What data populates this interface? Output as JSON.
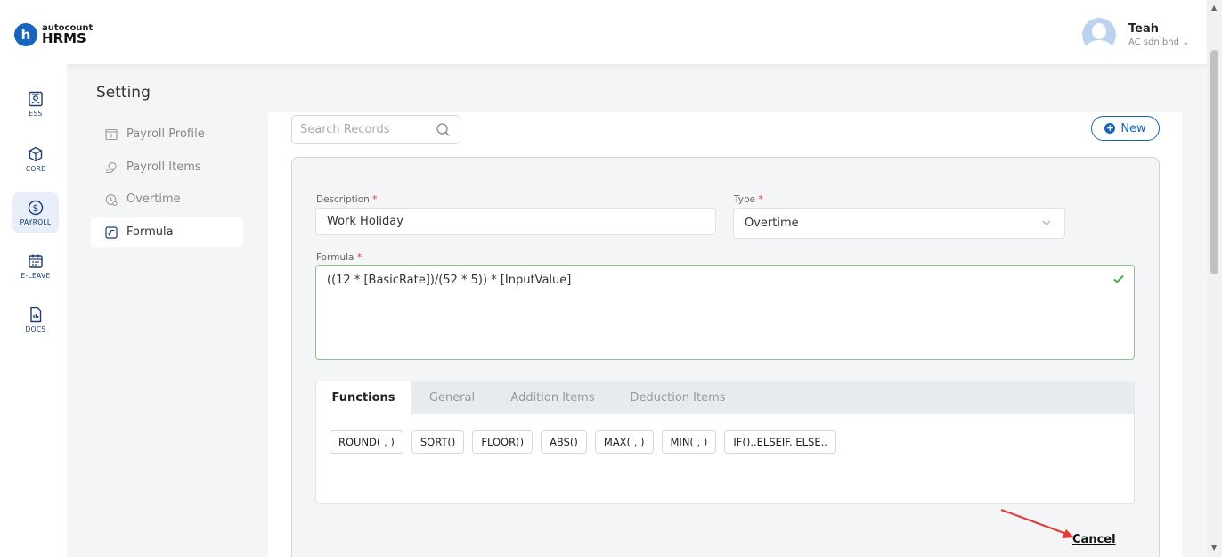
{
  "app": {
    "brand_top": "autocount",
    "brand_main": "HRMS",
    "logo_letter": "h"
  },
  "user": {
    "name": "Teah",
    "company": "AC sdn bhd"
  },
  "nav": [
    {
      "label": "ESS",
      "icon": "ess-icon"
    },
    {
      "label": "CORE",
      "icon": "cube-icon"
    },
    {
      "label": "PAYROLL",
      "icon": "dollar-icon",
      "active": true
    },
    {
      "label": "E-LEAVE",
      "icon": "calendar-icon"
    },
    {
      "label": "DOCS",
      "icon": "document-icon"
    }
  ],
  "page": {
    "title": "Setting"
  },
  "settings_menu": [
    {
      "label": "Payroll Profile",
      "icon": "profile-icon"
    },
    {
      "label": "Payroll Items",
      "icon": "items-icon"
    },
    {
      "label": "Overtime",
      "icon": "clock-icon"
    },
    {
      "label": "Formula",
      "icon": "formula-icon",
      "active": true
    }
  ],
  "search": {
    "placeholder": "Search Records"
  },
  "new_button": {
    "label": "New"
  },
  "form": {
    "description_label": "Description",
    "description_value": "Work Holiday",
    "type_label": "Type",
    "type_value": "Overtime",
    "formula_label": "Formula",
    "formula_value": "((12 * [BasicRate])/(52 * 5)) * [InputValue]",
    "required_mark": "*"
  },
  "tabs": [
    "Functions",
    "General",
    "Addition Items",
    "Deduction Items"
  ],
  "functions": [
    "ROUND( , )",
    "SQRT()",
    "FLOOR()",
    "ABS()",
    "MAX( , )",
    "MIN( , )",
    "IF()..ELSEIF..ELSE.."
  ],
  "actions": {
    "cancel_label": "Cancel"
  },
  "colors": {
    "accent": "#1565c0",
    "valid": "#4caf50",
    "annotation_arrow": "#e53935"
  }
}
